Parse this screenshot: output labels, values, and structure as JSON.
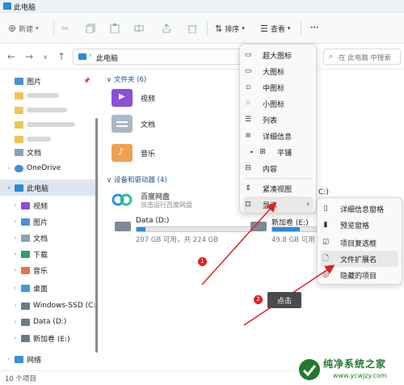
{
  "window": {
    "title": "此电脑"
  },
  "toolbar": {
    "new_label": "新建",
    "sort_label": "排序",
    "view_label": "查看",
    "more_label": "···"
  },
  "address": {
    "path": "此电脑",
    "search_placeholder": "在 此电脑 中搜索"
  },
  "sidebar": {
    "items": [
      {
        "label": "图片"
      },
      {
        "label": "文档"
      },
      {
        "label": "OneDrive"
      },
      {
        "label": "此电脑"
      },
      {
        "label": "视频"
      },
      {
        "label": "图片"
      },
      {
        "label": "文档"
      },
      {
        "label": "下载"
      },
      {
        "label": "音乐"
      },
      {
        "label": "桌面"
      },
      {
        "label": "Windows-SSD (C:)"
      },
      {
        "label": "Data (D:)"
      },
      {
        "label": "新加卷 (E:)"
      },
      {
        "label": "网络"
      }
    ]
  },
  "main": {
    "folders_group": "文件夹 (6)",
    "folders": [
      {
        "label": "视频"
      },
      {
        "label": "文档"
      },
      {
        "label": "音乐"
      }
    ],
    "devices_group": "设备和驱动器 (4)",
    "baidu": {
      "name": "百度网盘",
      "sub": "双击运行百度网盘"
    },
    "c_drive_suffix": "C:)",
    "drives": [
      {
        "name": "Data (D:)",
        "size": "207 GB 可用，共 224 GB",
        "used_fraction": 0.08
      },
      {
        "name": "新加卷 (E:)",
        "size": "49.8 GB 可用",
        "used_fraction": 0.5
      }
    ]
  },
  "view_menu": {
    "items": [
      {
        "label": "超大图标",
        "icon": "monitor-icon"
      },
      {
        "label": "大图标",
        "icon": "monitor-icon"
      },
      {
        "label": "中图标",
        "icon": "monitor-icon"
      },
      {
        "label": "小图标",
        "icon": "grid-icon"
      },
      {
        "label": "列表",
        "icon": "list-icon"
      },
      {
        "label": "详细信息",
        "icon": "details-icon"
      },
      {
        "label": "平铺",
        "icon": "tiles-icon",
        "checked": true
      },
      {
        "label": "内容",
        "icon": "content-icon"
      },
      {
        "label": "紧凑视图",
        "icon": "compact-icon"
      },
      {
        "label": "显示",
        "icon": "show-icon",
        "submenu": true
      }
    ]
  },
  "show_submenu": {
    "items": [
      {
        "label": "详细信息窗格",
        "icon": "pane-icon"
      },
      {
        "label": "预览窗格",
        "icon": "preview-icon"
      },
      {
        "label": "项目复选框",
        "icon": "checkbox-icon"
      },
      {
        "label": "文件扩展名",
        "icon": "file-icon"
      },
      {
        "label": "隐藏的项目",
        "icon": "eye-icon"
      }
    ]
  },
  "annotations": {
    "step1": "1",
    "step2": "2",
    "tooltip": "点击"
  },
  "statusbar": {
    "count": "10 个项目"
  },
  "watermark": {
    "name": "纯净系统之家",
    "url": "www.ycwjzy.com"
  },
  "colors": {
    "accent": "#2a8bd8",
    "annotation": "#e02020"
  }
}
